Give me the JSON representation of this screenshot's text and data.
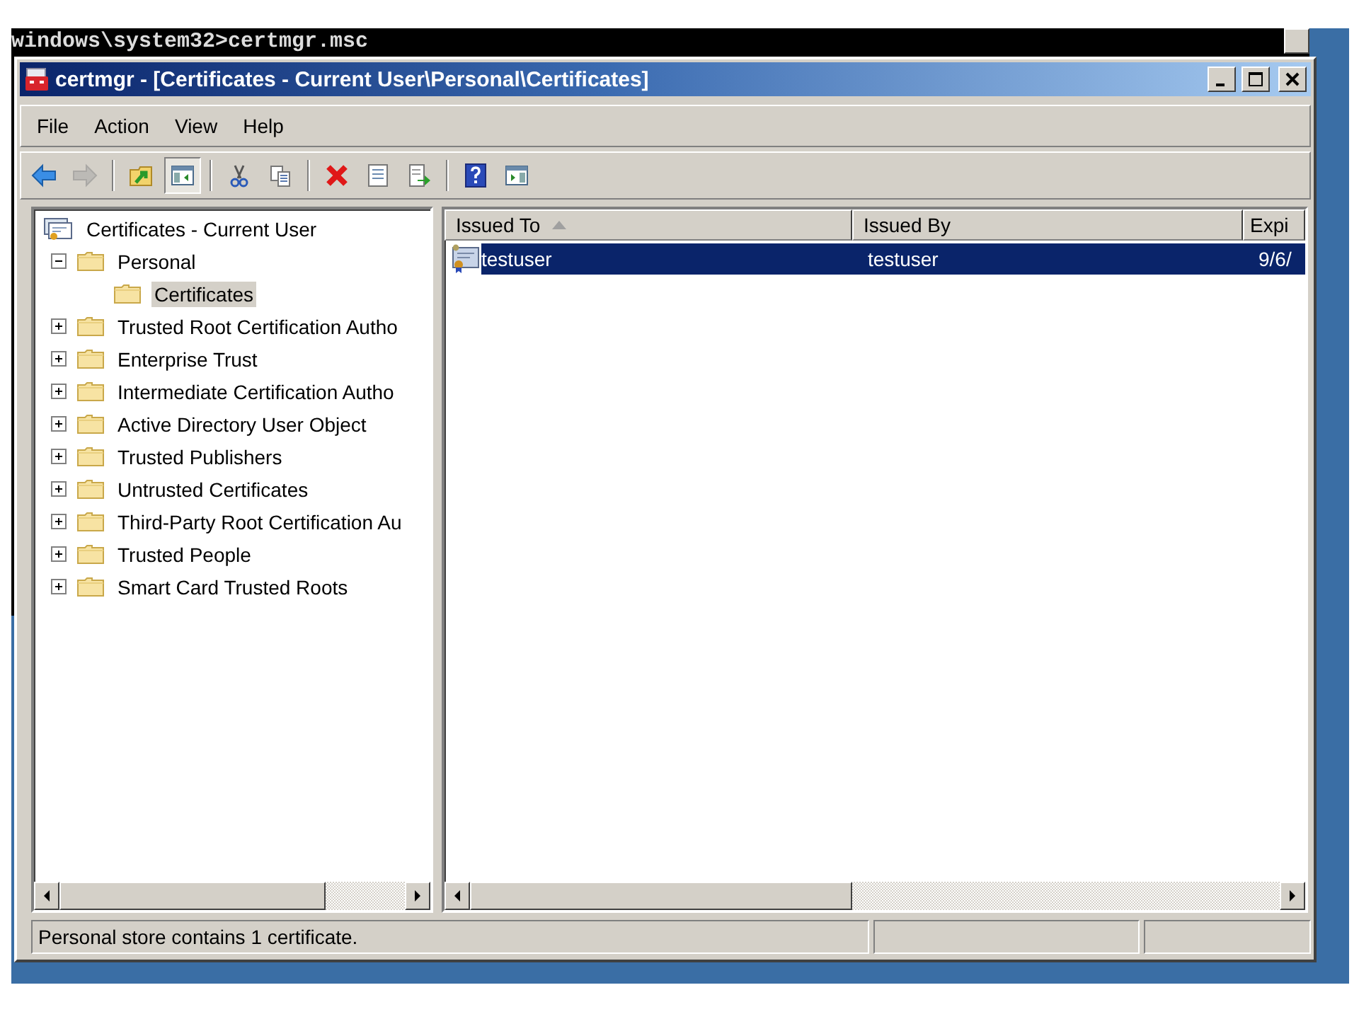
{
  "console": {
    "command": "windows\\system32>certmgr.msc"
  },
  "window": {
    "title": "certmgr - [Certificates - Current User\\Personal\\Certificates]"
  },
  "menu": [
    "File",
    "Action",
    "View",
    "Help"
  ],
  "toolbar": [
    {
      "kind": "back",
      "pressed": false,
      "disabled": false
    },
    {
      "kind": "forward",
      "pressed": false,
      "disabled": true
    },
    {
      "kind": "separator"
    },
    {
      "kind": "up",
      "pressed": false,
      "disabled": false
    },
    {
      "kind": "console-tree",
      "pressed": true,
      "disabled": false
    },
    {
      "kind": "separator"
    },
    {
      "kind": "cut",
      "pressed": false,
      "disabled": false
    },
    {
      "kind": "copy",
      "pressed": false,
      "disabled": false
    },
    {
      "kind": "separator"
    },
    {
      "kind": "delete",
      "pressed": false,
      "disabled": false
    },
    {
      "kind": "properties",
      "pressed": false,
      "disabled": false
    },
    {
      "kind": "export",
      "pressed": false,
      "disabled": false
    },
    {
      "kind": "separator"
    },
    {
      "kind": "help",
      "pressed": false,
      "disabled": false
    },
    {
      "kind": "action-pane",
      "pressed": false,
      "disabled": false
    }
  ],
  "tree": {
    "label": "Certificates - Current User",
    "selected": false,
    "children": [
      {
        "label": "Personal",
        "expanded": true,
        "selected": false,
        "children": [
          {
            "label": "Certificates",
            "selected": true
          }
        ]
      },
      {
        "label": "Trusted Root Certification Autho",
        "expanded": false,
        "selected": false
      },
      {
        "label": "Enterprise Trust",
        "expanded": false,
        "selected": false
      },
      {
        "label": "Intermediate Certification Autho",
        "expanded": false,
        "selected": false
      },
      {
        "label": "Active Directory User Object",
        "expanded": false,
        "selected": false
      },
      {
        "label": "Trusted Publishers",
        "expanded": false,
        "selected": false
      },
      {
        "label": "Untrusted Certificates",
        "expanded": false,
        "selected": false
      },
      {
        "label": "Third-Party Root Certification Au",
        "expanded": false,
        "selected": false
      },
      {
        "label": "Trusted People",
        "expanded": false,
        "selected": false
      },
      {
        "label": "Smart Card Trusted Roots",
        "expanded": false,
        "selected": false
      }
    ]
  },
  "table": {
    "columns": [
      {
        "label": "Issued To",
        "sorted": true
      },
      {
        "label": "Issued By",
        "sorted": false
      },
      {
        "label": "Expi",
        "sorted": false
      }
    ],
    "rows": [
      {
        "cells": [
          "testuser",
          "testuser",
          "9/6/"
        ],
        "selected": true
      }
    ]
  },
  "status_bar": {
    "text": "Personal store contains 1 certificate."
  }
}
